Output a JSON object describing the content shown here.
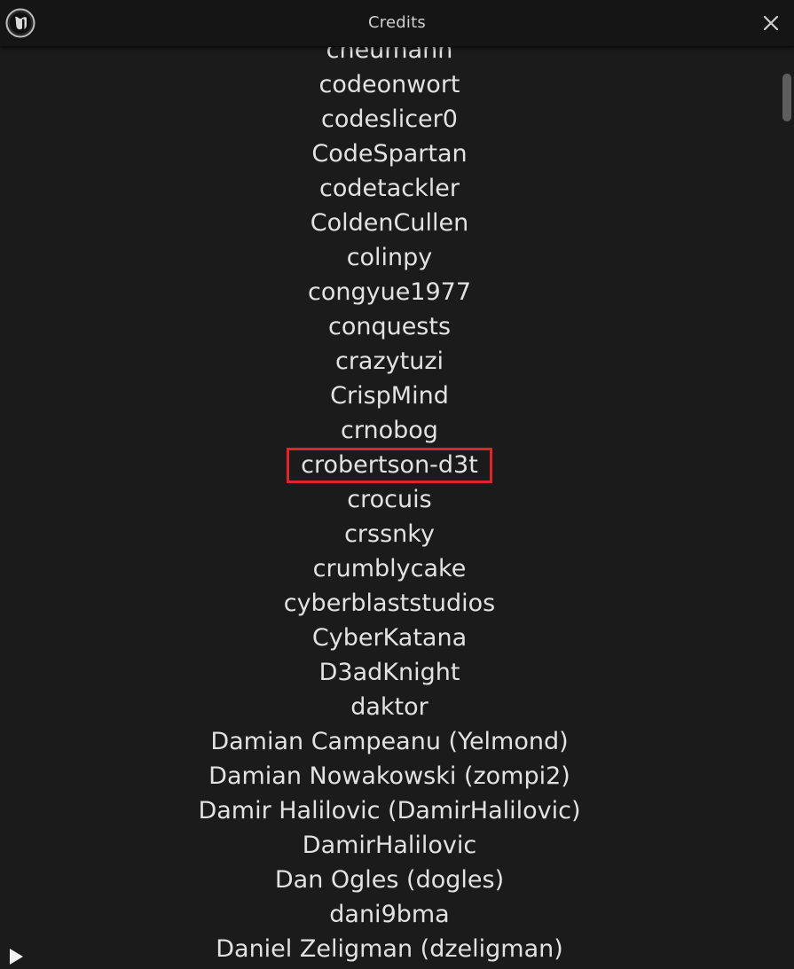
{
  "window": {
    "title": "Credits"
  },
  "icons": {
    "logo": "unreal-engine-logo-icon",
    "close": "close-icon",
    "expand": "play-triangle-icon"
  },
  "colors": {
    "background": "#1b1b1b",
    "titlebar": "#151515",
    "text": "#e2e2e2",
    "highlight_border": "#e0242b"
  },
  "credits": {
    "highlighted_index": 13,
    "names": [
      "cneumann",
      "codeonwort",
      "codeslicer0",
      "CodeSpartan",
      "codetackler",
      "ColdenCullen",
      "colinpy",
      "congyue1977",
      "conquests",
      "crazytuzi",
      "CrispMind",
      "crnobog",
      "crobertson-d3t",
      "crocuis",
      "crssnky",
      "crumblycake",
      "cyberblaststudios",
      "CyberKatana",
      "D3adKnight",
      "daktor",
      "Damian Campeanu (Yelmond)",
      "Damian Nowakowski (zompi2)",
      "Damir Halilovic (DamirHalilovic)",
      "DamirHalilovic",
      "Dan Ogles (dogles)",
      "dani9bma",
      "Daniel Zeligman (dzeligman)"
    ]
  }
}
